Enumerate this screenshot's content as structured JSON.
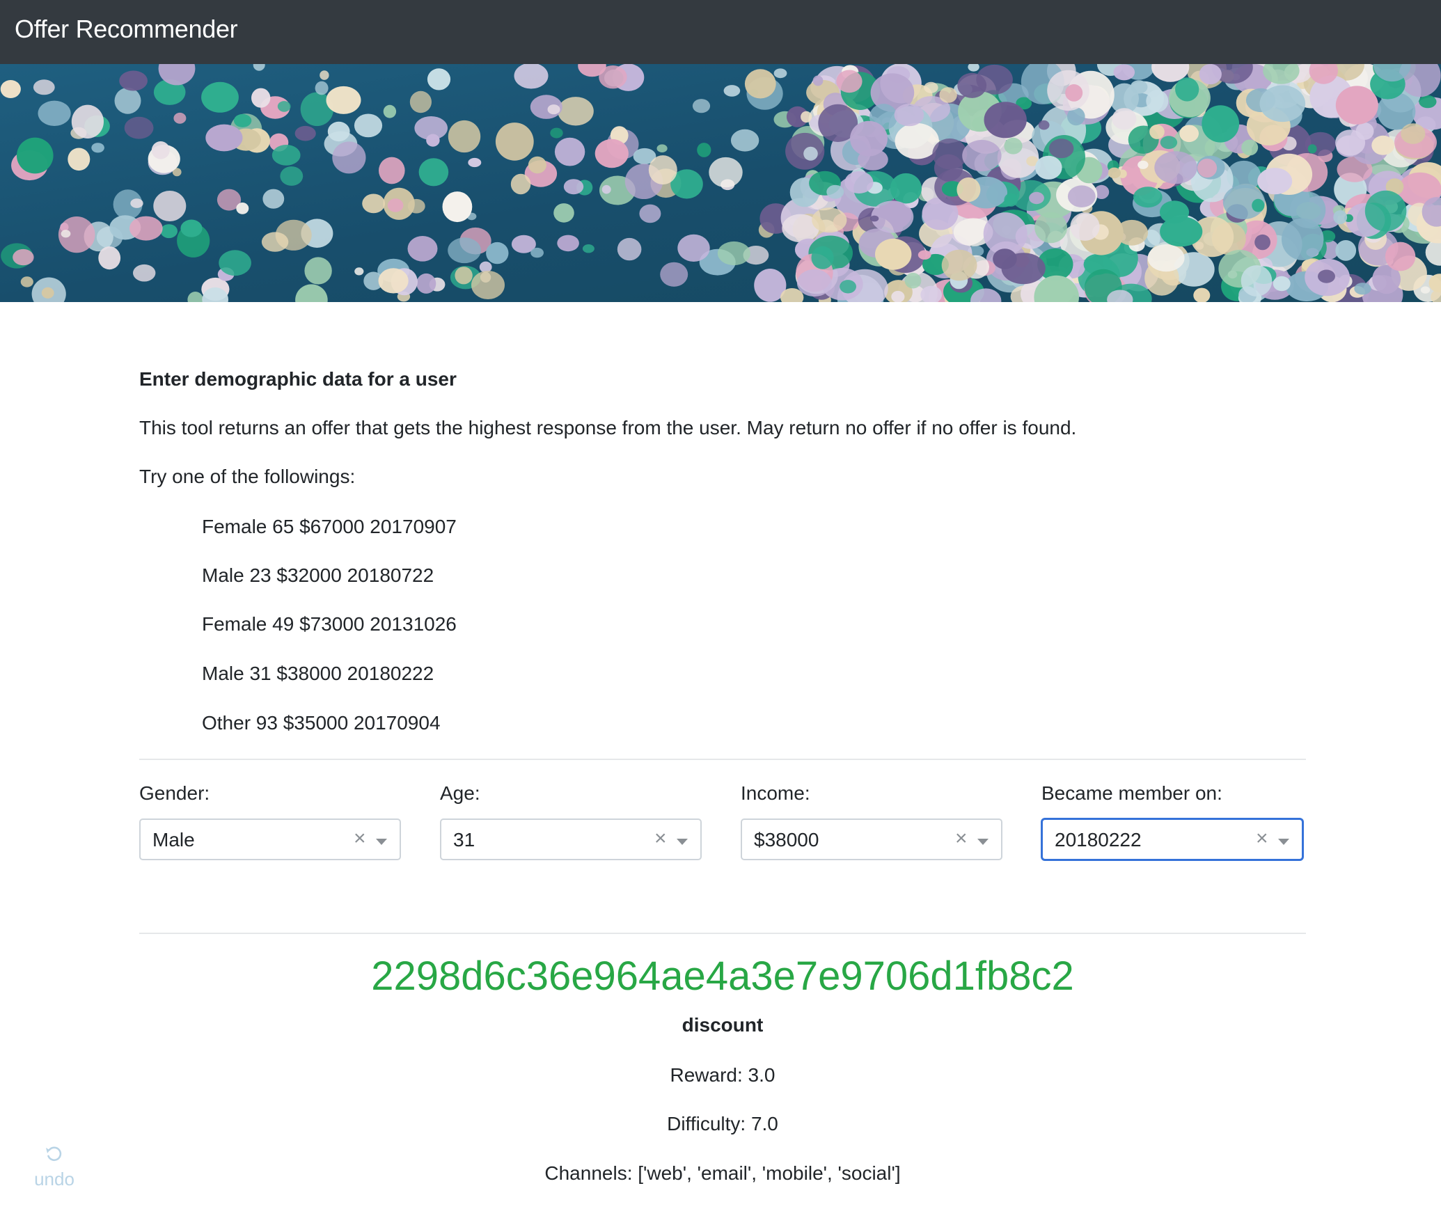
{
  "app": {
    "title": "Offer Recommender"
  },
  "intro": {
    "heading": "Enter demographic data for a user",
    "description": "This tool returns an offer that gets the highest response from the user. May return no offer if no offer is found.",
    "try_label": "Try one of the followings:",
    "examples": [
      "Female 65 $67000 20170907",
      "Male 23 $32000 20180722",
      "Female 49 $73000 20131026",
      "Male 31 $38000 20180222",
      "Other 93 $35000 20170904"
    ]
  },
  "form": {
    "gender": {
      "label": "Gender:",
      "value": "Male"
    },
    "age": {
      "label": "Age:",
      "value": "31"
    },
    "income": {
      "label": "Income:",
      "value": "$38000"
    },
    "member_since": {
      "label": "Became member on:",
      "value": "20180222"
    },
    "clear_glyph": "×"
  },
  "result": {
    "offer_id": "2298d6c36e964ae4a3e7e9706d1fb8c2",
    "offer_type": "discount",
    "reward": "Reward: 3.0",
    "difficulty": "Difficulty: 7.0",
    "channels": "Channels: ['web', 'email', 'mobile', 'social']"
  },
  "undo": {
    "label": "undo",
    "icon": "undo-icon"
  },
  "colors": {
    "navbar": "#343a40",
    "offer_id": "#28a745",
    "focus_border": "#3572d9",
    "undo": "#b9d4e6"
  }
}
